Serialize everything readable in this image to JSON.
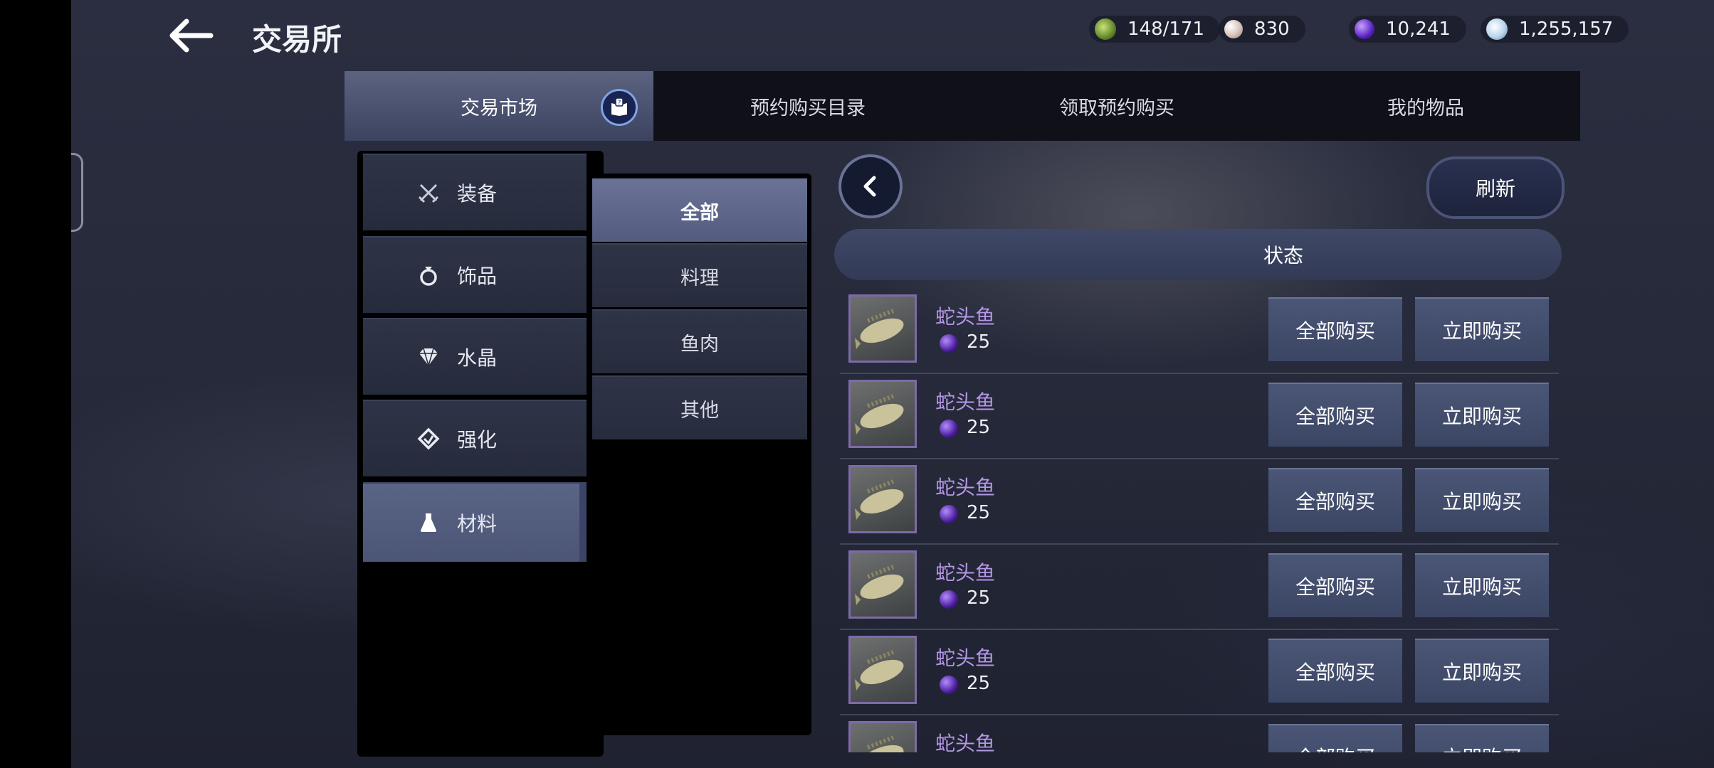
{
  "header": {
    "title": "交易所",
    "exit_label": "退出"
  },
  "resources": [
    {
      "icon": "energy-icon",
      "value": "148/171",
      "color": "#7fae3a"
    },
    {
      "icon": "pearl-icon",
      "value": "830",
      "color": "#e8d6cf"
    },
    {
      "icon": "purple-gem-icon",
      "value": "10,241",
      "color": "#6a2bcf"
    },
    {
      "icon": "silver-coin-icon",
      "value": "1,255,157",
      "color": "#cfe3f5"
    }
  ],
  "tabs": [
    {
      "label": "交易市场",
      "active": true
    },
    {
      "label": "预约购买目录",
      "active": false
    },
    {
      "label": "领取预约购买",
      "active": false
    },
    {
      "label": "我的物品",
      "active": false
    }
  ],
  "categories": [
    {
      "label": "装备",
      "icon": "crossed-swords-icon",
      "active": false
    },
    {
      "label": "饰品",
      "icon": "ring-icon",
      "active": false
    },
    {
      "label": "水晶",
      "icon": "diamond-icon",
      "active": false
    },
    {
      "label": "强化",
      "icon": "enhance-icon",
      "active": false
    },
    {
      "label": "材料",
      "icon": "flask-icon",
      "active": true
    }
  ],
  "subcategories": [
    {
      "label": "全部",
      "active": true
    },
    {
      "label": "料理",
      "active": false
    },
    {
      "label": "鱼肉",
      "active": false
    },
    {
      "label": "其他",
      "active": false
    }
  ],
  "list": {
    "refresh_label": "刷新",
    "status_header": "状态",
    "items": [
      {
        "name": "蛇头鱼",
        "price": "25",
        "buy_all_label": "全部购买",
        "buy_now_label": "立即购买"
      },
      {
        "name": "蛇头鱼",
        "price": "25",
        "buy_all_label": "全部购买",
        "buy_now_label": "立即购买"
      },
      {
        "name": "蛇头鱼",
        "price": "25",
        "buy_all_label": "全部购买",
        "buy_now_label": "立即购买"
      },
      {
        "name": "蛇头鱼",
        "price": "25",
        "buy_all_label": "全部购买",
        "buy_now_label": "立即购买"
      },
      {
        "name": "蛇头鱼",
        "price": "25",
        "buy_all_label": "全部购买",
        "buy_now_label": "立即购买"
      },
      {
        "name": "蛇头鱼",
        "price": "",
        "buy_all_label": "全部购买",
        "buy_now_label": "立即购买"
      }
    ]
  }
}
